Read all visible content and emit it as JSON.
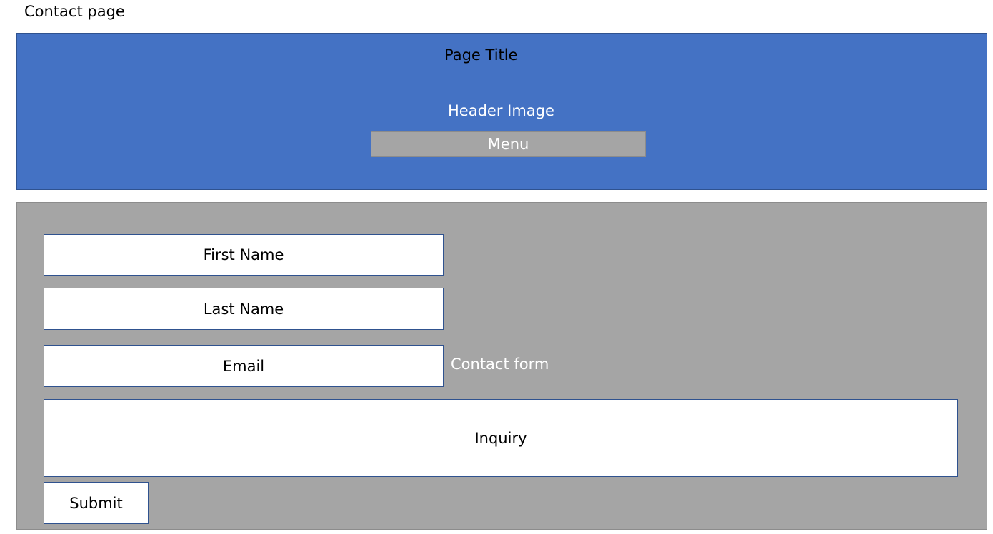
{
  "page_label": "Contact page",
  "header": {
    "title": "Page Title",
    "image_label": "Header Image",
    "menu_label": "Menu"
  },
  "form": {
    "section_label": "Contact form",
    "first_name": "First Name",
    "last_name": "Last Name",
    "email": "Email",
    "inquiry": "Inquiry",
    "submit": "Submit"
  },
  "colors": {
    "header_bg": "#4472c4",
    "menu_bg": "#a5a5a5",
    "form_bg": "#a5a5a5",
    "field_bg": "#ffffff",
    "field_border": "#2f528f"
  }
}
